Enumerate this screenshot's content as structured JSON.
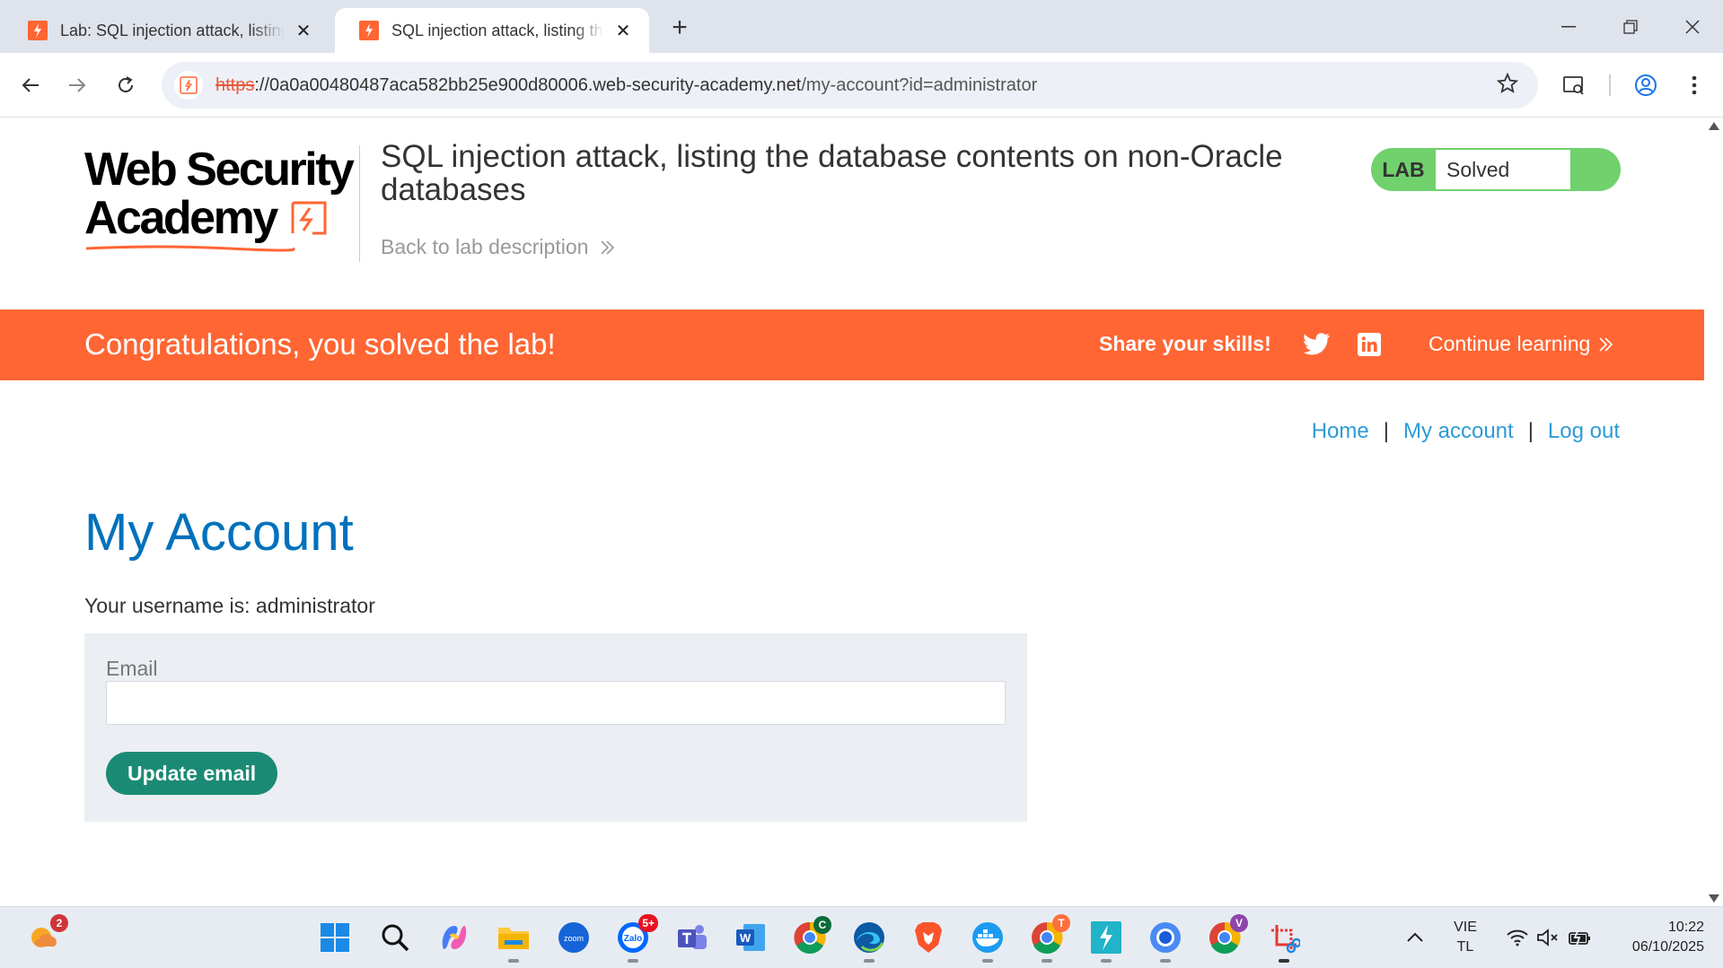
{
  "browser": {
    "tabs": [
      {
        "title": "Lab: SQL injection attack, listing the database contents on non-Oracle databases",
        "active": false
      },
      {
        "title": "SQL injection attack, listing the database contents on non-Oracle databases",
        "active": true
      }
    ],
    "url": {
      "scheme": "https",
      "host": "://0a0a00480487aca582bb25e900d80006.web-security-academy.net",
      "path": "/my-account?id=administrator"
    }
  },
  "header": {
    "logo_line1": "Web Security",
    "logo_line2": "Academy",
    "lab_title": "SQL injection attack, listing the database contents on non-Oracle databases",
    "back_link": "Back to lab description",
    "status_label": "LAB",
    "status_value": "Solved"
  },
  "banner": {
    "message": "Congratulations, you solved the lab!",
    "share": "Share your skills!",
    "continue": "Continue learning"
  },
  "nav": {
    "home": "Home",
    "separator": "|",
    "my_account": "My account",
    "logout": "Log out"
  },
  "account": {
    "heading": "My Account",
    "username_text": "Your username is: administrator",
    "email_label": "Email",
    "email_value": "",
    "update_button": "Update email"
  },
  "taskbar": {
    "weather_badge": "2",
    "zalo_badge": "5+",
    "chrome_c_badge": "C",
    "chrome_t_badge": "T",
    "chrome_v_badge": "V",
    "lang_line1": "VIE",
    "lang_line2": "TL",
    "time": "10:22",
    "date": "06/10/2025"
  },
  "colors": {
    "brand_orange": "#ff6633",
    "link_blue": "#2e9bd6",
    "heading_blue": "#0071bc",
    "solved_green": "#70d16d",
    "button_green": "#1a8a74"
  }
}
